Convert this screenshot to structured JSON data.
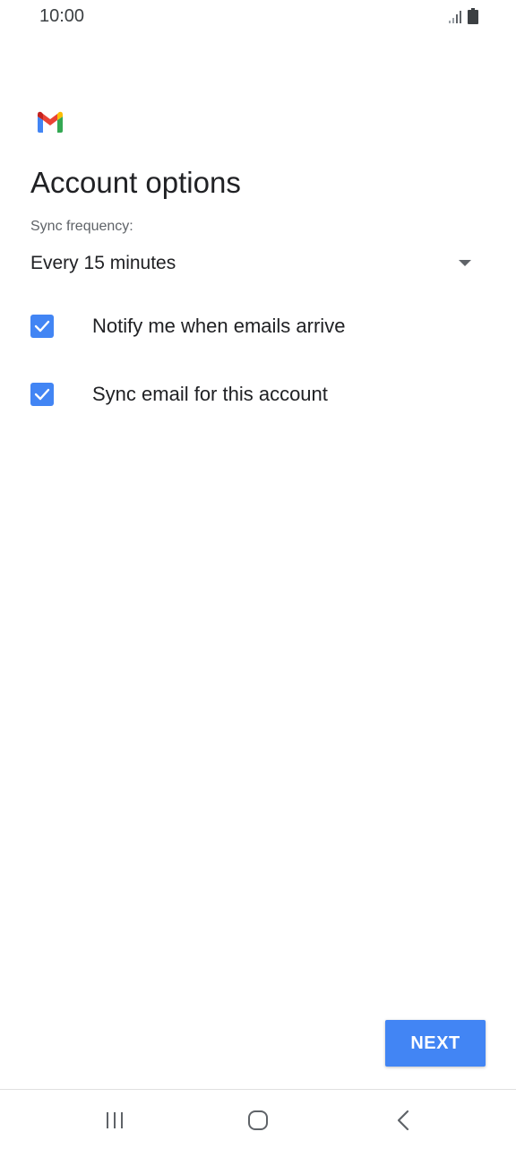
{
  "status_bar": {
    "time": "10:00",
    "icons": [
      "signal-icon",
      "battery-icon"
    ]
  },
  "app": {
    "logo": "gmail-logo-icon",
    "title": "Account options"
  },
  "sync": {
    "label": "Sync frequency:",
    "selected": "Every 15 minutes"
  },
  "options": [
    {
      "label": "Notify me when emails arrive",
      "checked": true
    },
    {
      "label": "Sync email for this account",
      "checked": true
    }
  ],
  "actions": {
    "next_label": "NEXT"
  },
  "navigation": {
    "buttons": [
      "recent-apps-icon",
      "home-icon",
      "back-icon"
    ]
  },
  "colors": {
    "accent": "#4285f4",
    "text": "#202124",
    "secondary_text": "#5f6368"
  }
}
